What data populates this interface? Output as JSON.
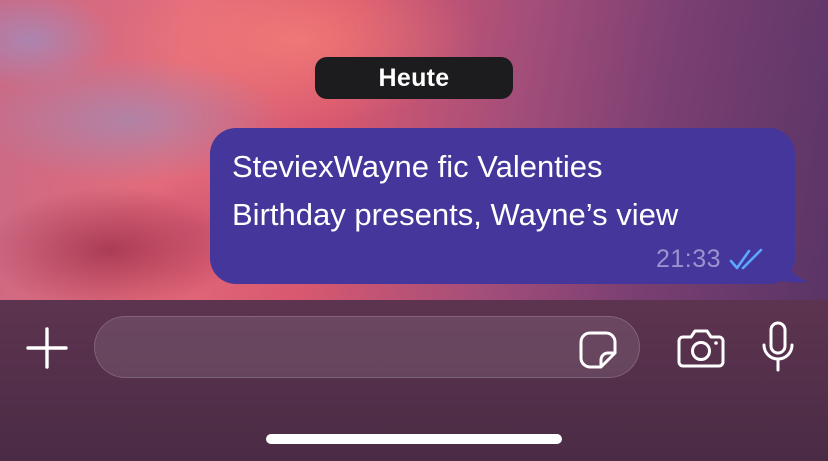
{
  "chat": {
    "date_separator": "Heute",
    "messages": [
      {
        "direction": "outgoing",
        "lines": [
          "SteviexWayne fic Valenties",
          "Birthday presents, Wayne’s view"
        ],
        "time": "21:33",
        "status": "read",
        "status_icon": "double-check-icon"
      }
    ],
    "bubble_color": "#44369a",
    "read_check_color": "#5aa8ff"
  },
  "composer": {
    "input_value": "",
    "icons": {
      "attach": "plus-icon",
      "sticker": "sticker-icon",
      "camera": "camera-icon",
      "microphone": "microphone-icon"
    }
  }
}
